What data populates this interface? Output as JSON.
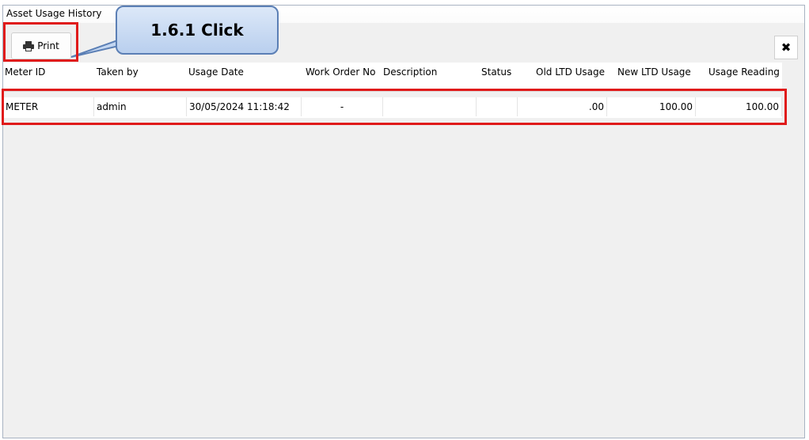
{
  "window": {
    "title": "Asset Usage History"
  },
  "toolbar": {
    "print_label": "Print",
    "close_glyph": "✖",
    "print_icon": "printer-icon",
    "close_icon": "close-icon"
  },
  "callout": {
    "text": "1.6.1 Click"
  },
  "table": {
    "headers": [
      "Meter ID",
      "Taken by",
      "Usage Date",
      "Work Order No",
      "Description",
      "Status",
      "Old LTD Usage",
      "New LTD Usage",
      "Usage Reading"
    ],
    "rows": [
      [
        "METER",
        "admin",
        "30/05/2024 11:18:42",
        "-",
        "",
        "",
        ".00",
        "100.00",
        "100.00"
      ]
    ]
  },
  "colors": {
    "highlight": "#e01b1b",
    "callout_border": "#5b7fb5"
  }
}
